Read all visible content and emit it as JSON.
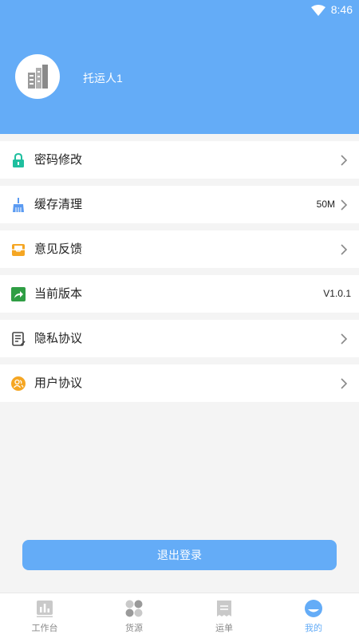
{
  "status_bar": {
    "time": "8:46",
    "wifi_icon": "wifi-icon"
  },
  "profile": {
    "name": "托运人1",
    "avatar_icon": "building-icon"
  },
  "menu": [
    {
      "label": "密码修改",
      "value": "",
      "icon": "lock-icon",
      "icon_color": "#1fbf9f",
      "arrow": true
    },
    {
      "label": "缓存清理",
      "value": "50M",
      "icon": "broom-icon",
      "icon_color": "#5b9bf2",
      "arrow": true
    },
    {
      "label": "意见反馈",
      "value": "",
      "icon": "mailbox-icon",
      "icon_color": "#f5a623",
      "arrow": true
    },
    {
      "label": "当前版本",
      "value": "V1.0.1",
      "icon": "share-icon",
      "icon_color": "#2f9e44",
      "arrow": false
    },
    {
      "label": "隐私协议",
      "value": "",
      "icon": "document-icon",
      "icon_color": "#444444",
      "arrow": true
    },
    {
      "label": "用户协议",
      "value": "",
      "icon": "users-icon",
      "icon_color": "#f5a623",
      "arrow": true
    }
  ],
  "logout_label": "退出登录",
  "tabs": [
    {
      "label": "工作台",
      "icon": "chart-icon",
      "active": false
    },
    {
      "label": "货源",
      "icon": "grid-icon",
      "active": false
    },
    {
      "label": "运单",
      "icon": "receipt-icon",
      "active": false
    },
    {
      "label": "我的",
      "icon": "profile-icon",
      "active": true
    }
  ],
  "colors": {
    "primary": "#64acf7",
    "background": "#f4f4f4"
  }
}
